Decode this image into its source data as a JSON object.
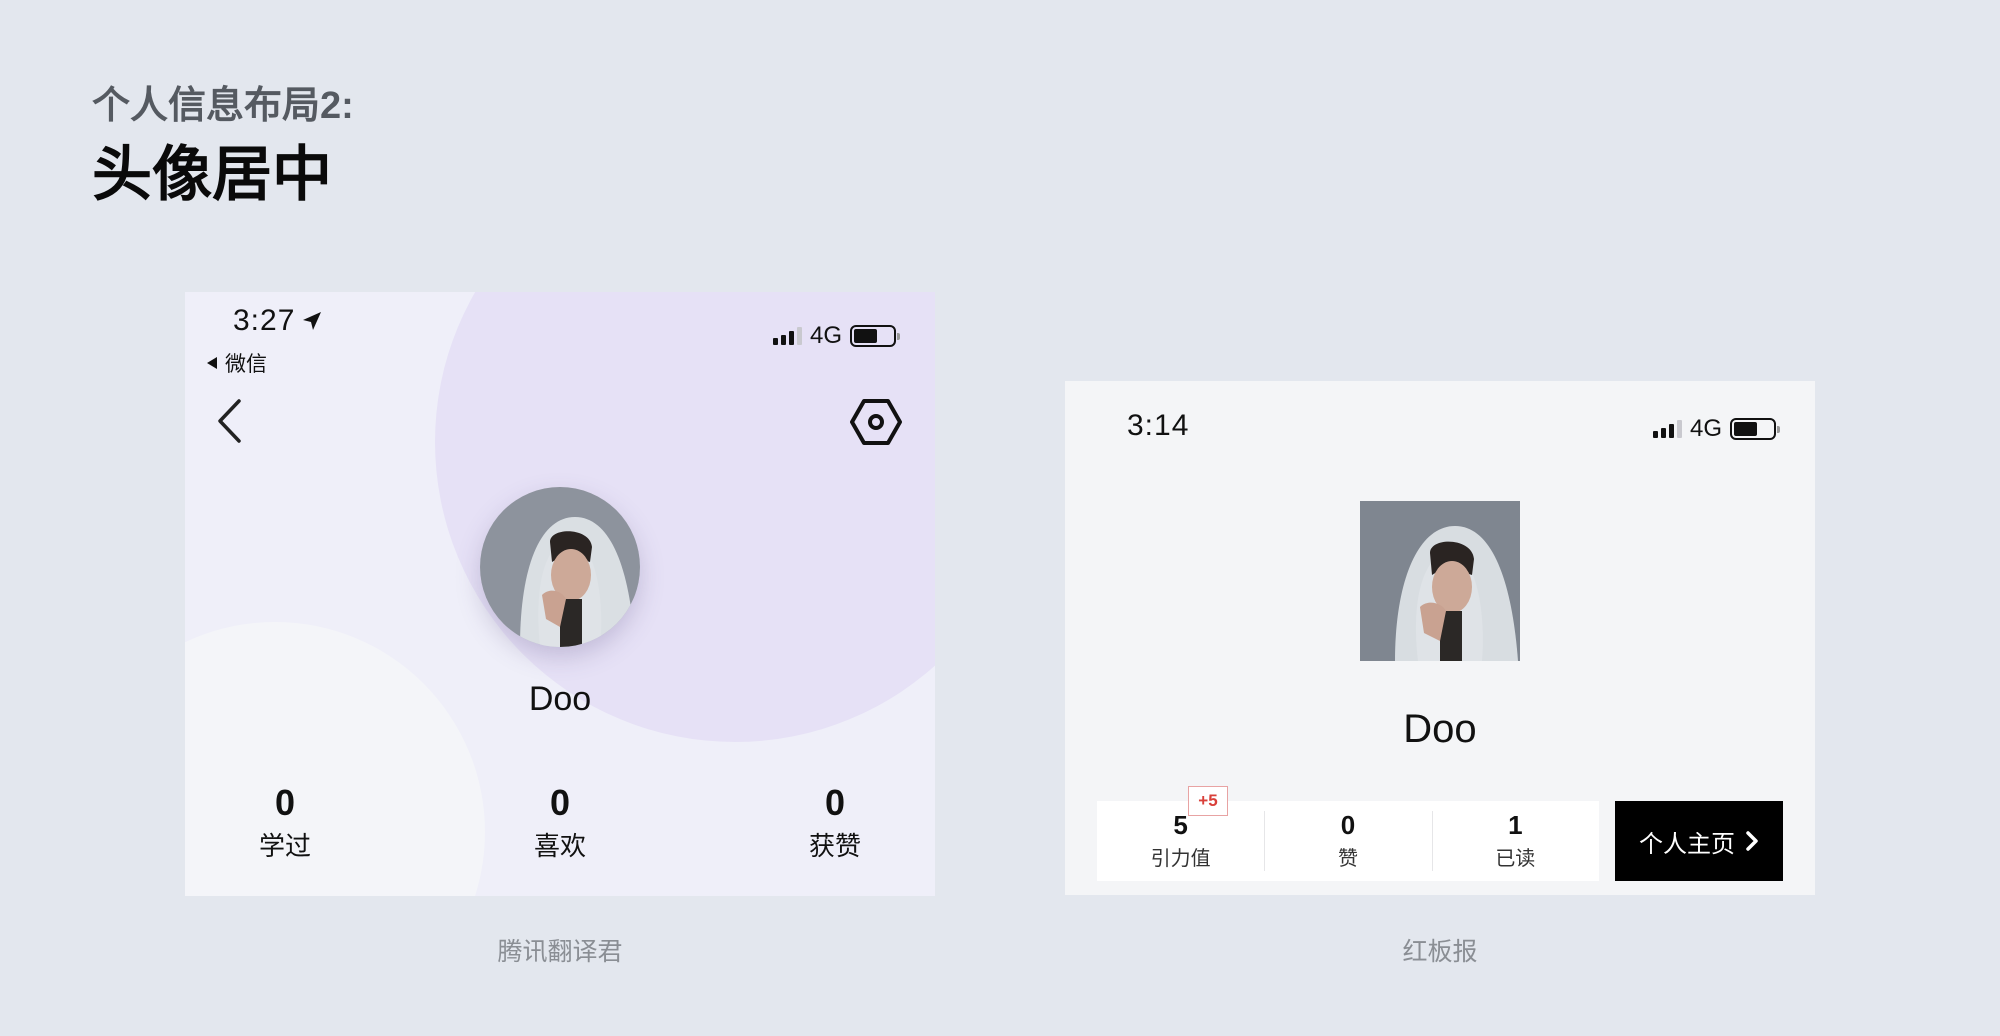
{
  "header": {
    "subtitle": "个人信息布局2:",
    "title": "头像居中"
  },
  "phone1": {
    "status": {
      "time": "3:27",
      "back_app": "微信",
      "network": "4G"
    },
    "profile": {
      "name": "Doo"
    },
    "stats": [
      {
        "value": "0",
        "label": "学过"
      },
      {
        "value": "0",
        "label": "喜欢"
      },
      {
        "value": "0",
        "label": "获赞"
      }
    ],
    "caption": "腾讯翻译君",
    "colors": {
      "background": "#efeff9",
      "accent_circle": "#e6e1f6"
    }
  },
  "phone2": {
    "status": {
      "time": "3:14",
      "network": "4G"
    },
    "profile": {
      "name": "Doo"
    },
    "stats": [
      {
        "value": "5",
        "label": "引力值"
      },
      {
        "value": "0",
        "label": "赞"
      },
      {
        "value": "1",
        "label": "已读"
      }
    ],
    "badge": "+5",
    "home_button": "个人主页",
    "caption": "红板报",
    "colors": {
      "badge": "#d9403a",
      "button": "#000000"
    }
  }
}
